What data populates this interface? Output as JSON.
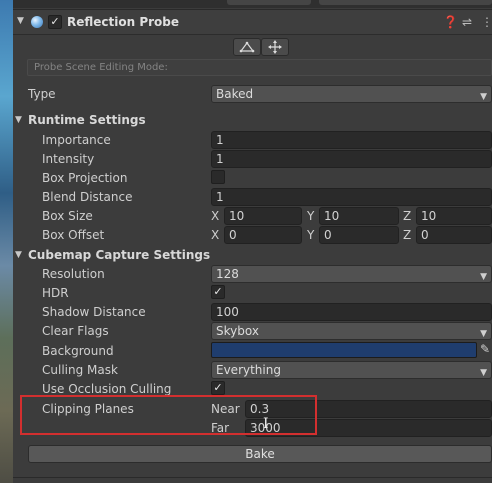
{
  "component": {
    "title": "Reflection Probe",
    "enabled": "✓",
    "edit_mode_label": "Probe Scene Editing Mode:"
  },
  "header_icons": {
    "help": "❓",
    "presets": "⇌",
    "menu": "⋮"
  },
  "type": {
    "label": "Type",
    "value": "Baked"
  },
  "runtime": {
    "title": "Runtime Settings",
    "importance": {
      "label": "Importance",
      "value": "1"
    },
    "intensity": {
      "label": "Intensity",
      "value": "1"
    },
    "box_projection": {
      "label": "Box Projection"
    },
    "blend_distance": {
      "label": "Blend Distance",
      "value": "1"
    },
    "box_size": {
      "label": "Box Size",
      "x": "10",
      "y": "10",
      "z": "10"
    },
    "box_offset": {
      "label": "Box Offset",
      "x": "0",
      "y": "0",
      "z": "0"
    }
  },
  "axes": {
    "x": "X",
    "y": "Y",
    "z": "Z"
  },
  "cubemap": {
    "title": "Cubemap Capture Settings",
    "resolution": {
      "label": "Resolution",
      "value": "128"
    },
    "hdr": {
      "label": "HDR",
      "checked": "✓"
    },
    "shadow_distance": {
      "label": "Shadow Distance",
      "value": "100"
    },
    "clear_flags": {
      "label": "Clear Flags",
      "value": "Skybox"
    },
    "background": {
      "label": "Background",
      "color": "#1f3d6e"
    },
    "culling_mask": {
      "label": "Culling Mask",
      "value": "Everything"
    },
    "occlusion": {
      "label": "Use Occlusion Culling",
      "checked": "✓"
    },
    "clipping": {
      "label": "Clipping Planes",
      "near_label": "Near",
      "near": "0.3",
      "far_label": "Far",
      "far": "3000"
    }
  },
  "bake_label": "Bake",
  "colors": {
    "highlight": "#d32f2f",
    "background_swatch": "#1f3d6e"
  }
}
